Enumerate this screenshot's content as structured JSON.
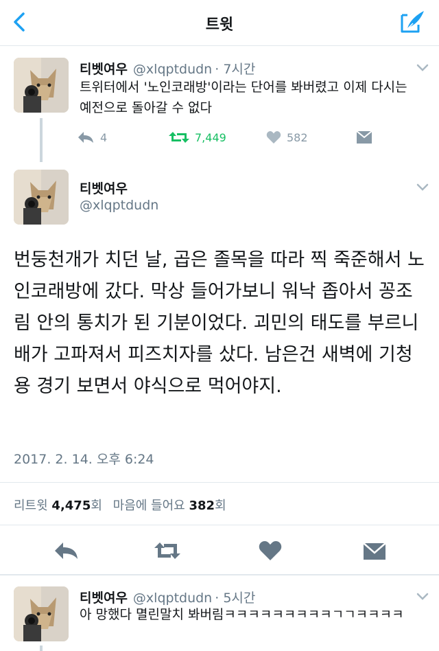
{
  "header": {
    "title": "트윗"
  },
  "tweet1": {
    "name": "티벳여우",
    "handle": "@xlqptdudn",
    "time": "· 7시간",
    "text": "트위터에서 '노인코래방'이라는 단어를 봐버렸고 이제 다시는 예전으로 돌아갈 수 없다",
    "reply_count": "4",
    "retweet_count": "7,449",
    "like_count": "582"
  },
  "main": {
    "name": "티벳여우",
    "handle": "@xlqptdudn",
    "text": "번둥천개가 치던 날, 곱은 졸목을 따라 찍 죽준해서 노인코래방에 갔다. 막상 들어가보니 워낙 좁아서 꽁조림 안의 통치가 된 기분이었다. 괴민의 태도를 부르니 배가 고파져서 피즈치자를 샀다. 남은건 새벽에 기청용 경기 보면서 야식으로 먹어야지.",
    "timestamp": "2017. 2. 14. 오후 6:24",
    "retweets_label": "리트윗",
    "retweets_value": "4,475",
    "retweets_unit": "회",
    "likes_label": "마음에 들어요",
    "likes_value": "382",
    "likes_unit": "회"
  },
  "tweet3": {
    "name": "티벳여우",
    "handle": "@xlqptdudn",
    "time": "· 5시간",
    "text": "아 망했다 멸린말치 봐버림ㅋㅋㅋㅋㅋㅋㅋㅋㅋㄱㄱㅋㅋㅋㅋ"
  },
  "colors": {
    "accent": "#1da1f2",
    "retweet_green": "#17bf63",
    "muted": "#8899a6",
    "icon_dark": "#657786"
  }
}
